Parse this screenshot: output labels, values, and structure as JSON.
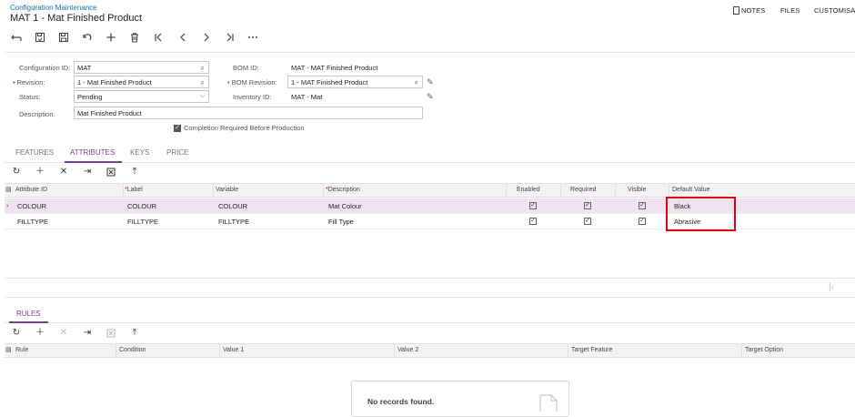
{
  "header": {
    "breadcrumb": "Configuration Maintenance",
    "title": "MAT 1 - Mat Finished Product",
    "notes_label": "NOTES",
    "files_label": "FILES",
    "customise_label": "CUSTOMISAT"
  },
  "form": {
    "configuration_id": {
      "label": "Configuration ID:",
      "value": "MAT"
    },
    "revision": {
      "label": "Revision:",
      "value": "1 - Mat Finished Product"
    },
    "status": {
      "label": "Status:",
      "value": "Pending"
    },
    "description": {
      "label": "Description:",
      "value": "Mat Finished Product"
    },
    "bom_id": {
      "label": "BOM ID:",
      "value": "MAT - MAT Finished Product"
    },
    "bom_revision": {
      "label": "BOM Revision:",
      "value": "1 - MAT Finished Product"
    },
    "inventory_id": {
      "label": "Inventory ID:",
      "value": "MAT - Mat"
    },
    "completion_required": {
      "label": "Completion Required Before Production",
      "checked": true
    }
  },
  "tabs": [
    {
      "label": "FEATURES",
      "active": false
    },
    {
      "label": "ATTRIBUTES",
      "active": true
    },
    {
      "label": "KEYS",
      "active": false
    },
    {
      "label": "PRICE",
      "active": false
    }
  ],
  "attributes_grid": {
    "columns": {
      "attribute_id": "Attribute ID",
      "label": "Label",
      "variable": "Variable",
      "description": "Description",
      "enabled": "Enabled",
      "required": "Required",
      "visible": "Visible",
      "default_value": "Default Value"
    },
    "rows": [
      {
        "attribute_id": "COLOUR",
        "label": "COLOUR",
        "variable": "COLOUR",
        "description": "Mat Colour",
        "enabled": true,
        "required": true,
        "visible": true,
        "default_value": "Black"
      },
      {
        "attribute_id": "FILLTYPE",
        "label": "FILLTYPE",
        "variable": "FILLTYPE",
        "description": "Fill Type",
        "enabled": true,
        "required": true,
        "visible": true,
        "default_value": "Abrasive"
      }
    ]
  },
  "rules_tab": {
    "label": "RULES"
  },
  "rules_grid": {
    "columns": {
      "rule": "Rule",
      "condition": "Condition",
      "value1": "Value 1",
      "value2": "Value 2",
      "target_feature": "Target Feature",
      "target_option": "Target Option"
    },
    "empty_text": "No records found."
  },
  "colors": {
    "accent": "#7e3a99",
    "link": "#1a6fb5",
    "highlight_box": "#e00010"
  }
}
